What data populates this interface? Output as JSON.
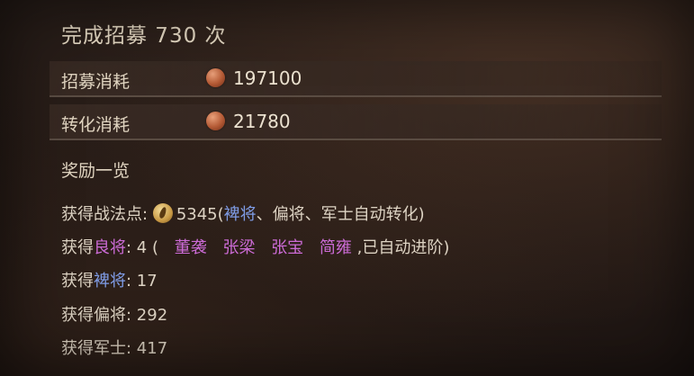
{
  "title": "完成招募 730 次",
  "rows": [
    {
      "label": "招募消耗",
      "value": "197100",
      "icon": "copper-coin-icon"
    },
    {
      "label": "转化消耗",
      "value": "21780",
      "icon": "copper-coin-icon"
    }
  ],
  "rewards": {
    "heading": "奖励一览",
    "points": {
      "prefix": "获得战法点:",
      "value": "5345",
      "open": "(",
      "grade1": "裨将",
      "sep1": "、",
      "grade2": "偏将",
      "rest": "、军士自动转化)"
    },
    "good": {
      "prefix": "获得",
      "grade": "良将",
      "count": ": 4 (",
      "generals": [
        "董袭",
        "张梁",
        "张宝",
        "简雍"
      ],
      "suffix": ",已自动进阶)"
    },
    "bijiang": {
      "prefix": "获得",
      "grade": "裨将",
      "count": ": 17"
    },
    "pianjiang": {
      "prefix": "获得",
      "grade": "偏将",
      "count": ": 292"
    },
    "junshi": {
      "prefix": "获得军士",
      "count": ": 417"
    }
  },
  "colors": {
    "blue_grade": "#7f9ce6",
    "purple_grade": "#cc6bd6"
  }
}
